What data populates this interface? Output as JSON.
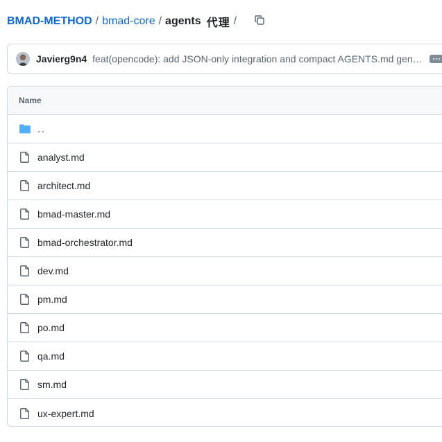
{
  "breadcrumb": {
    "root": "BMAD-METHOD",
    "separator": "/",
    "folder": "bmad-core",
    "current": "agents",
    "annotation": "代理",
    "copy_icon": "copy-icon"
  },
  "commit": {
    "author": "Javierg9n4",
    "message": "feat(opencode): add JSON-only integration and compact AGENTS.md generator",
    "avatar_icon": "avatar-icon",
    "more_icon": "ellipsis-icon"
  },
  "table": {
    "header": "Name",
    "parent_row": "..",
    "files": [
      "analyst.md",
      "architect.md",
      "bmad-master.md",
      "bmad-orchestrator.md",
      "dev.md",
      "pm.md",
      "po.md",
      "qa.md",
      "sm.md",
      "ux-expert.md"
    ]
  },
  "colors": {
    "link": "#0969da",
    "folder": "#54aeff",
    "border": "#d1d9e0",
    "muted": "#59636e"
  }
}
